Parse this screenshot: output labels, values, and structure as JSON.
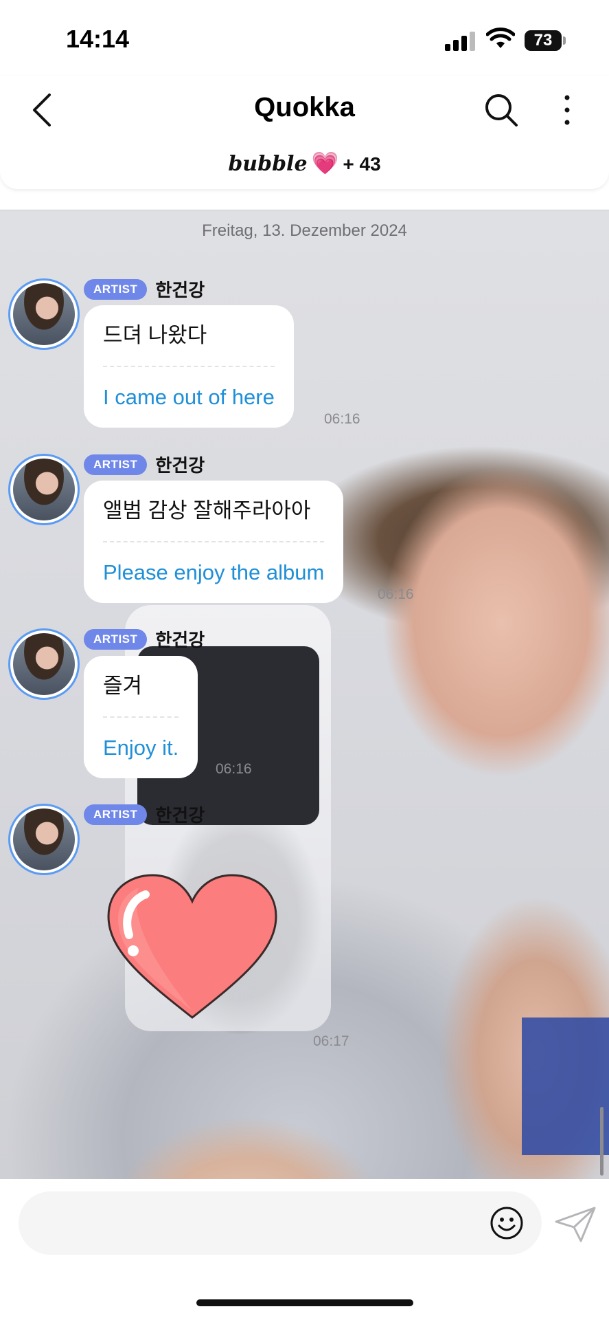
{
  "status_bar": {
    "time": "14:14",
    "battery": "73"
  },
  "header": {
    "title": "Quokka",
    "brand": "bubble",
    "heart": "💗",
    "plus_count": "+ 43"
  },
  "date_label": "Freitag, 13. Dezember 2024",
  "messages": [
    {
      "badge": "ARTIST",
      "sender": "한건강",
      "original": "드뎌 나왔다",
      "translation": "I came out of here",
      "time": "06:16"
    },
    {
      "badge": "ARTIST",
      "sender": "한건강",
      "original": "앨범 감상 잘해주라아아",
      "translation": "Please enjoy the album",
      "time": "06:16"
    },
    {
      "badge": "ARTIST",
      "sender": "한건강",
      "original": "즐겨",
      "translation": "Enjoy it.",
      "time": "06:16"
    },
    {
      "badge": "ARTIST",
      "sender": "한건강",
      "sticker": "heart-sticker",
      "time": "06:17"
    }
  ],
  "input": {
    "placeholder": ""
  },
  "colors": {
    "badge": "#6f87e8",
    "translation": "#1f8fd8",
    "avatar_ring": "#5c9bf2"
  }
}
